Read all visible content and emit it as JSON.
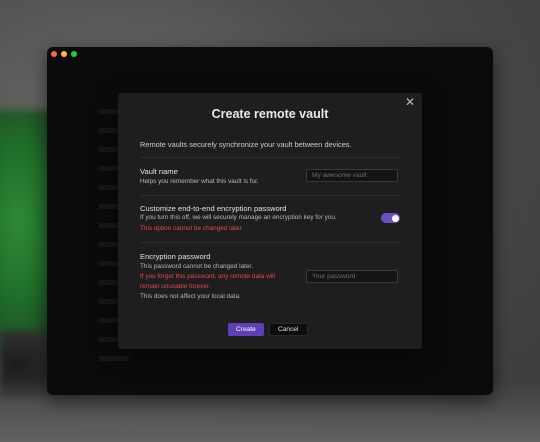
{
  "dialog": {
    "title": "Create remote vault",
    "intro": "Remote vaults securely synchronize your vault between devices.",
    "close_icon": "close-icon"
  },
  "vault_name": {
    "label": "Vault name",
    "description": "Helps you remember what this vault is for.",
    "value": "",
    "placeholder": "My awesome vault"
  },
  "encryption_toggle": {
    "label": "Customize end-to-end encryption password",
    "description": "If you turn this off, we will securely manage an encryption key for you.",
    "warning": "This option cannot be changed later.",
    "enabled": true,
    "accent": "#6e4fc4"
  },
  "encryption_password": {
    "label": "Encryption password",
    "description": "This password cannot be changed later.",
    "warning_line1": "If you forget this password, any remote data will",
    "warning_line2": "remain unusable forever.",
    "note": "This does not affect your local data.",
    "value": "",
    "placeholder": "Your password"
  },
  "buttons": {
    "create": "Create",
    "cancel": "Cancel"
  },
  "colors": {
    "primary_button": "#5f3fb8",
    "warning_text": "#e5484d",
    "dialog_bg": "#1e1e1e"
  }
}
